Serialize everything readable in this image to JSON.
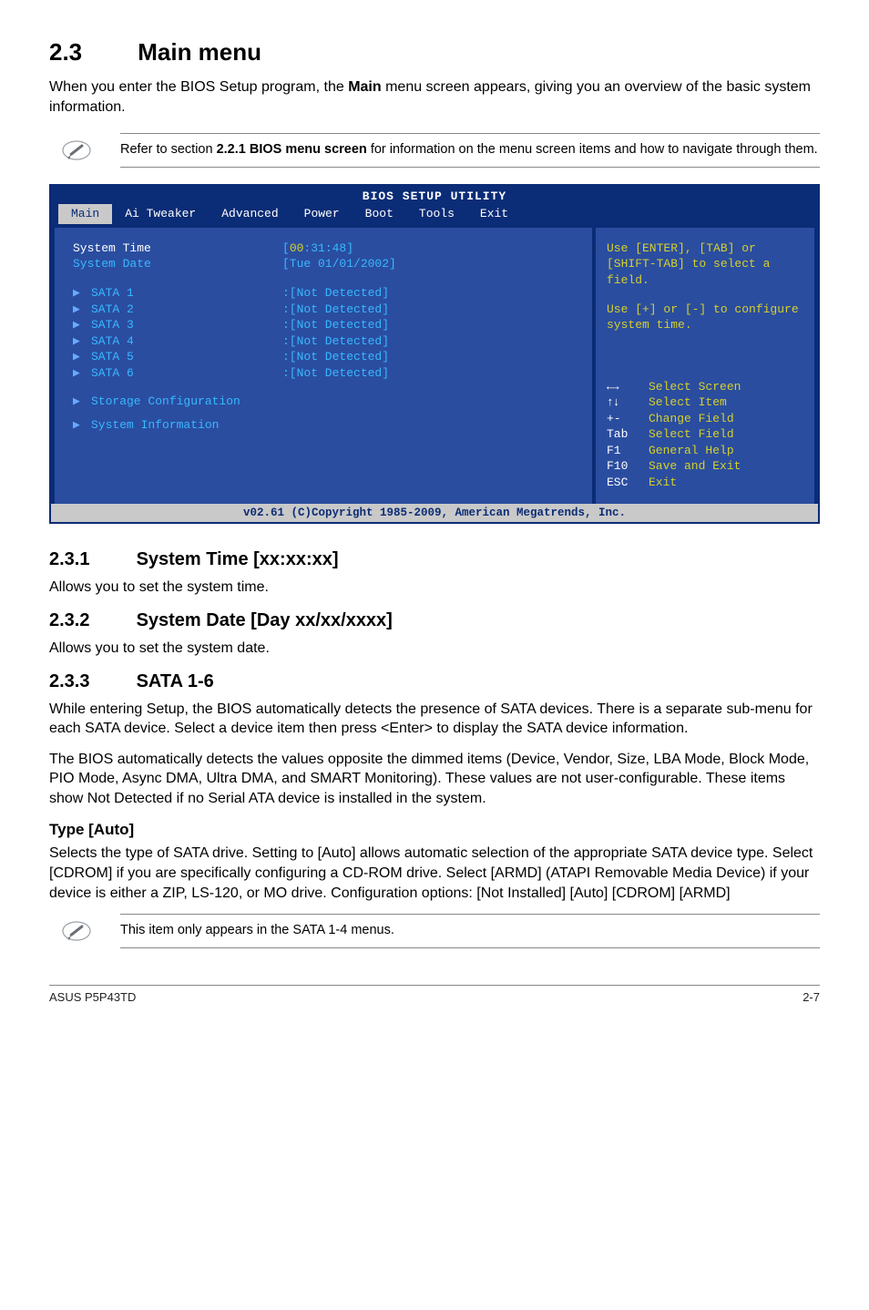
{
  "section": {
    "number": "2.3",
    "title": "Main menu"
  },
  "intro_pre": "When you enter the BIOS Setup program, the ",
  "intro_bold": "Main",
  "intro_post": " menu screen appears, giving you an overview of the basic system information.",
  "note1_pre": "Refer to section ",
  "note1_bold": "2.2.1 BIOS menu screen",
  "note1_post": " for information on the menu screen items and how to navigate through them.",
  "bios": {
    "title": "BIOS SETUP UTILITY",
    "tabs": [
      "Main",
      "Ai Tweaker",
      "Advanced",
      "Power",
      "Boot",
      "Tools",
      "Exit"
    ],
    "active_tab": 0,
    "left": {
      "system_time_label": "System Time",
      "system_time_value_open": "[",
      "system_time_hh": "00",
      "system_time_rest": ":31:48]",
      "system_date_label": "System Date",
      "system_date_value": "[Tue 01/01/2002]",
      "sata": [
        {
          "label": "SATA 1",
          "value": ":[Not Detected]"
        },
        {
          "label": "SATA 2",
          "value": ":[Not Detected]"
        },
        {
          "label": "SATA 3",
          "value": ":[Not Detected]"
        },
        {
          "label": "SATA 4",
          "value": ":[Not Detected]"
        },
        {
          "label": "SATA 5",
          "value": ":[Not Detected]"
        },
        {
          "label": "SATA 6",
          "value": ":[Not Detected]"
        }
      ],
      "storage_cfg": "Storage Configuration",
      "system_info": "System Information"
    },
    "right": {
      "help1": "Use [ENTER], [TAB] or [SHIFT-TAB] to select a field.",
      "help2": "Use [+] or [-] to configure system time.",
      "legend": [
        {
          "key": "←→",
          "text": "Select Screen",
          "keyClass": "arrows"
        },
        {
          "key": "↑↓",
          "text": "Select Item",
          "keyClass": "updown"
        },
        {
          "key": "+-",
          "text": "Change Field",
          "keyClass": ""
        },
        {
          "key": "Tab",
          "text": "Select Field",
          "keyClass": ""
        },
        {
          "key": "F1",
          "text": "General Help",
          "keyClass": ""
        },
        {
          "key": "F10",
          "text": "Save and Exit",
          "keyClass": ""
        },
        {
          "key": "ESC",
          "text": "Exit",
          "keyClass": ""
        }
      ]
    },
    "copyright": "v02.61 (C)Copyright 1985-2009, American Megatrends, Inc."
  },
  "s231": {
    "num": "2.3.1",
    "title": "System Time [xx:xx:xx]",
    "body": "Allows you to set the system time."
  },
  "s232": {
    "num": "2.3.2",
    "title": "System Date [Day xx/xx/xxxx]",
    "body": "Allows you to set the system date."
  },
  "s233": {
    "num": "2.3.3",
    "title": "SATA 1-6",
    "body1": "While entering Setup, the BIOS automatically detects the presence of SATA devices. There is a separate sub-menu for each SATA device. Select a device item then press <Enter> to display the SATA device information.",
    "body2": "The BIOS automatically detects the values opposite the dimmed items (Device, Vendor, Size, LBA Mode, Block Mode, PIO Mode, Async DMA, Ultra DMA, and SMART Monitoring). These values are not user-configurable. These items show Not Detected if no Serial ATA device is installed in the system."
  },
  "type_auto": {
    "title": "Type [Auto]",
    "body": "Selects the type of SATA drive. Setting to [Auto] allows automatic selection of the appropriate SATA device type. Select [CDROM] if you are specifically configuring a CD-ROM drive. Select [ARMD] (ATAPI Removable Media Device) if your device is either a ZIP, LS-120, or MO drive. Configuration options: [Not Installed] [Auto] [CDROM] [ARMD]"
  },
  "note2": "This item only appears in the SATA 1-4 menus.",
  "footer": {
    "left": "ASUS P5P43TD",
    "right": "2-7"
  }
}
